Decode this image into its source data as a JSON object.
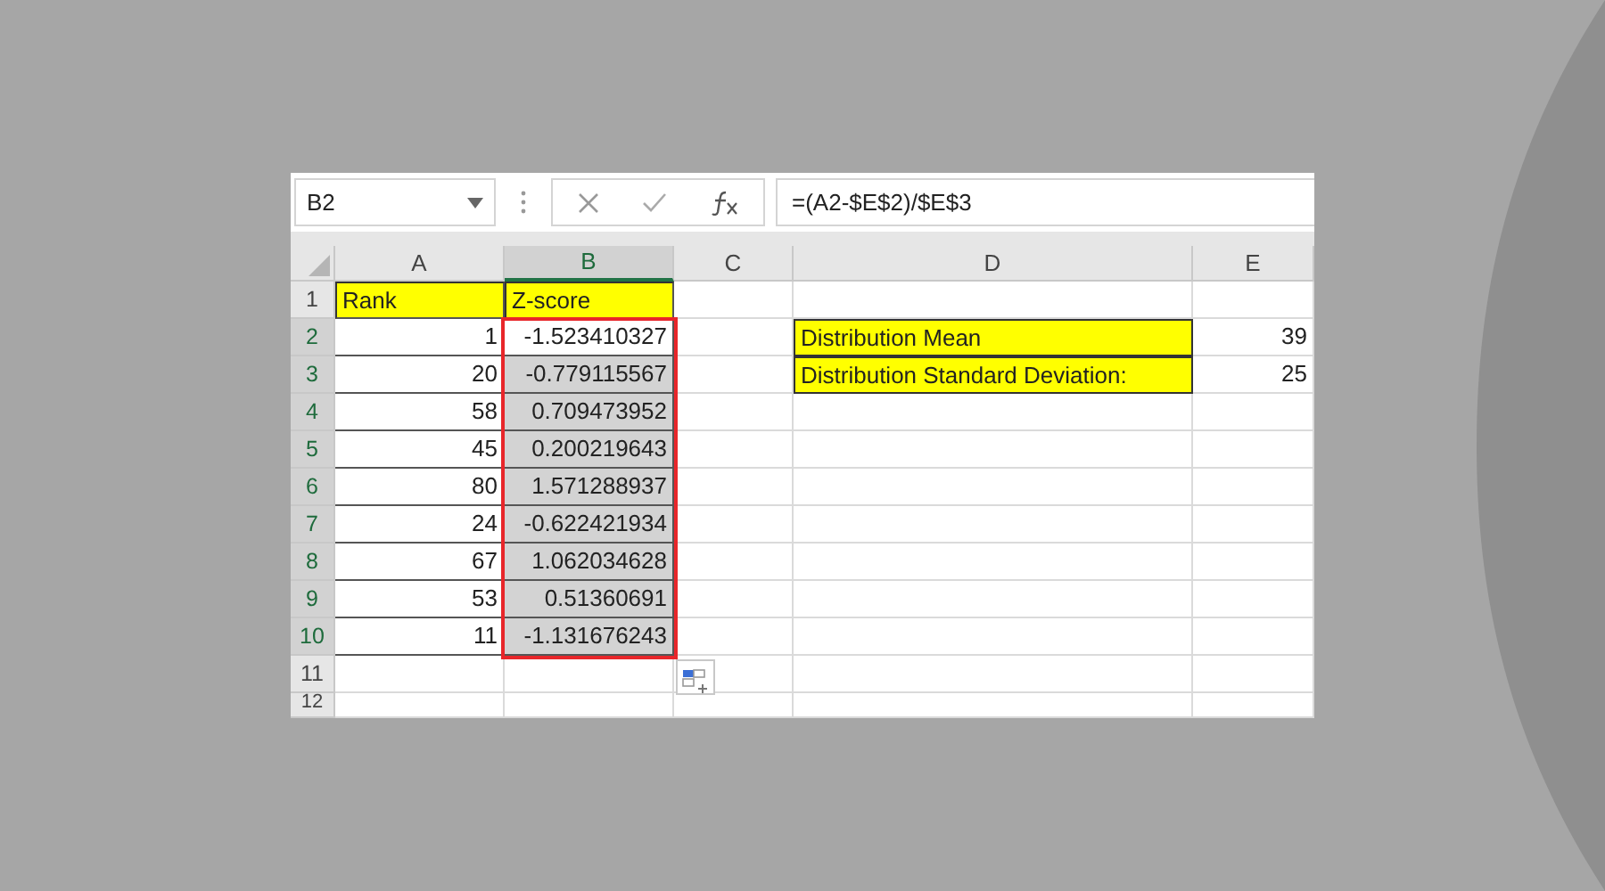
{
  "formula_bar": {
    "name_box": "B2",
    "formula": "=(A2-$E$2)/$E$3"
  },
  "columns": [
    {
      "label": "A",
      "selected": false
    },
    {
      "label": "B",
      "selected": true
    },
    {
      "label": "C",
      "selected": false
    },
    {
      "label": "D",
      "selected": false
    },
    {
      "label": "E",
      "selected": false
    }
  ],
  "rows": [
    {
      "header": "1",
      "selected": false,
      "A": {
        "text": "Rank",
        "highlighted": true
      },
      "B": {
        "text": "Z-score",
        "highlighted": true,
        "selected": false
      }
    },
    {
      "header": "2",
      "selected": true,
      "A": {
        "text": "1",
        "highlighted": false
      },
      "B": {
        "text": "-1.523410327",
        "highlighted": false,
        "selected": false
      },
      "D": {
        "text": "Distribution Mean",
        "highlighted": true
      },
      "E": {
        "text": "39",
        "highlighted": false
      }
    },
    {
      "header": "3",
      "selected": true,
      "A": {
        "text": "20",
        "highlighted": false
      },
      "B": {
        "text": "-0.779115567",
        "highlighted": false,
        "selected": true
      },
      "D": {
        "text": "Distribution Standard Deviation:",
        "highlighted": true
      },
      "E": {
        "text": "25",
        "highlighted": false
      }
    },
    {
      "header": "4",
      "selected": true,
      "A": {
        "text": "58",
        "highlighted": false
      },
      "B": {
        "text": "0.709473952",
        "highlighted": false,
        "selected": true
      }
    },
    {
      "header": "5",
      "selected": true,
      "A": {
        "text": "45",
        "highlighted": false
      },
      "B": {
        "text": "0.200219643",
        "highlighted": false,
        "selected": true
      }
    },
    {
      "header": "6",
      "selected": true,
      "A": {
        "text": "80",
        "highlighted": false
      },
      "B": {
        "text": "1.571288937",
        "highlighted": false,
        "selected": true
      }
    },
    {
      "header": "7",
      "selected": true,
      "A": {
        "text": "24",
        "highlighted": false
      },
      "B": {
        "text": "-0.622421934",
        "highlighted": false,
        "selected": true
      }
    },
    {
      "header": "8",
      "selected": true,
      "A": {
        "text": "67",
        "highlighted": false
      },
      "B": {
        "text": "1.062034628",
        "highlighted": false,
        "selected": true
      }
    },
    {
      "header": "9",
      "selected": true,
      "A": {
        "text": "53",
        "highlighted": false
      },
      "B": {
        "text": "0.51360691",
        "highlighted": false,
        "selected": true
      }
    },
    {
      "header": "10",
      "selected": true,
      "A": {
        "text": "11",
        "highlighted": false
      },
      "B": {
        "text": "-1.131676243",
        "highlighted": false,
        "selected": true
      }
    },
    {
      "header": "11",
      "selected": false
    },
    {
      "header": "12",
      "selected": false
    }
  ]
}
